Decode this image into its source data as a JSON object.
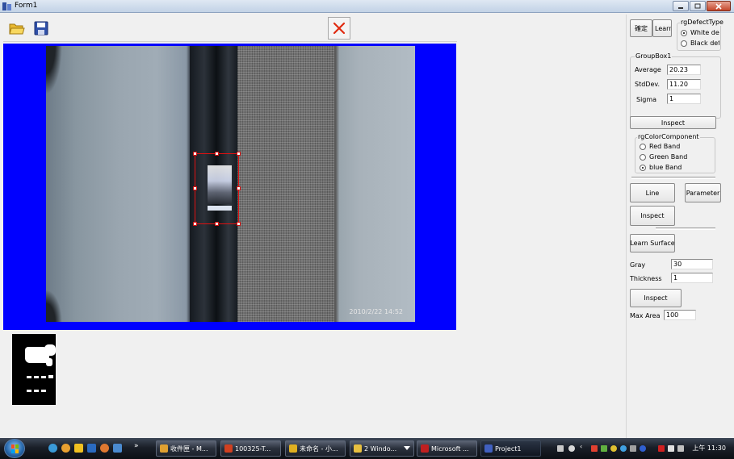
{
  "window": {
    "title": "Form1"
  },
  "toolbar": {
    "open_icon": "folder-open-icon",
    "save_icon": "floppy-save-icon",
    "close_icon": "red-x-icon"
  },
  "image_view": {
    "timestamp": "2010/2/22 14:52"
  },
  "right_panel": {
    "confirm_button": "確定",
    "learn_button": "Learn",
    "defect_type": {
      "title": "rgDefectType",
      "options": [
        "White defe",
        "Black defe"
      ],
      "selected": "White defe"
    },
    "groupbox1": {
      "title": "GroupBox1",
      "average_label": "Average",
      "average_value": "20.23",
      "stddev_label": "StdDev.",
      "stddev_value": "11.20",
      "sigma_label": "Sigma",
      "sigma_value": "1"
    },
    "inspect1_button": "Inspect",
    "color_component": {
      "title": "rgColorComponent",
      "options": [
        "Red Band",
        "Green Band",
        "blue Band"
      ],
      "selected": "blue Band"
    },
    "line_button": "Line",
    "parameter_button": "Parameter",
    "inspect2_button": "Inspect",
    "learn_surface_button": "Learn Surface",
    "gray_label": "Gray",
    "gray_value": "30",
    "thickness_label": "Thickness",
    "thickness_value": "1",
    "inspect3_button": "Inspect",
    "max_area_label": "Max Area",
    "max_area_value": "100"
  },
  "taskbar": {
    "more_glyph": "»",
    "tasks": [
      {
        "label": "收件匣 - M...",
        "icon": "mail-icon",
        "color": "#e0a030"
      },
      {
        "label": "100325-T...",
        "icon": "presentation-icon",
        "color": "#d04020"
      },
      {
        "label": "未命名 - 小...",
        "icon": "paint-icon",
        "color": "#e0b020"
      },
      {
        "label": "2 Windo...",
        "icon": "folder-icon",
        "color": "#e8c040"
      },
      {
        "label": "Microsoft ...",
        "icon": "office-icon",
        "color": "#c02020"
      },
      {
        "label": "Project1",
        "icon": "visual-basic-icon",
        "color": "#4060c0"
      }
    ],
    "clock": "上午 11:30"
  },
  "colors": {
    "viewer_background": "#0000ff",
    "roi_border": "#e01010",
    "panel_background": "#f0f0f0"
  }
}
